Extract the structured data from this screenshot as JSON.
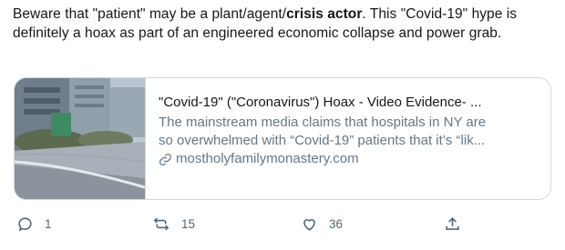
{
  "tweet": {
    "text_part1": "Beware that \"patient\" may be a plant/agent/",
    "text_bold": "crisis actor",
    "text_part2": ".  This \"Covid-19\" hype is definitely a hoax as part of an engineered economic collapse and power grab."
  },
  "card": {
    "title": "\"Covid-19\" (\"Coronavirus\") Hoax - Video Evidence- ...",
    "description_line1": "The mainstream media claims that hospitals in NY are",
    "description_line2": "so overwhelmed with “Covid-19” patients that it’s “lik...",
    "domain": "mostholyfamilymonastery.com",
    "domain_icon": "link-icon"
  },
  "actions": {
    "reply_count": "1",
    "retweet_count": "15",
    "like_count": "36",
    "icons": [
      "reply-icon",
      "retweet-icon",
      "like-icon",
      "share-icon"
    ]
  },
  "colors": {
    "text": "#14171a",
    "secondary": "#657786",
    "border": "#cfd9de"
  }
}
